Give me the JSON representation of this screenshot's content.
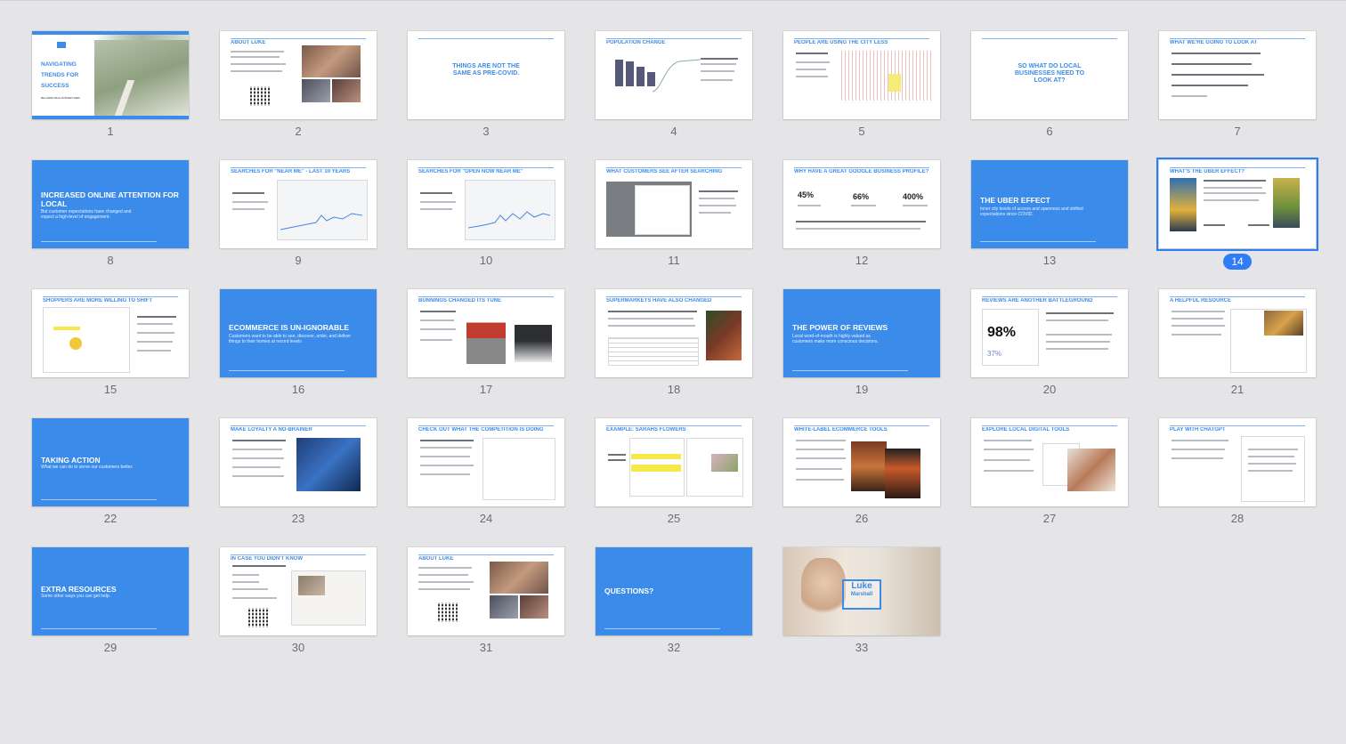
{
  "selected": 14,
  "slides": [
    {
      "n": "1",
      "title": "NAVIGATING TRENDS FOR SUCCESS",
      "sub": "BELLARINE SMALL BUSINESS WEEK"
    },
    {
      "n": "2",
      "title": "ABOUT LUKE"
    },
    {
      "n": "3",
      "title": "THINGS ARE NOT THE SAME AS PRE-COVID."
    },
    {
      "n": "4",
      "title": "POPULATION CHANGE"
    },
    {
      "n": "5",
      "title": "PEOPLE ARE USING THE CITY LESS"
    },
    {
      "n": "6",
      "title": "SO WHAT DO LOCAL BUSINESSES NEED TO LOOK AT?"
    },
    {
      "n": "7",
      "title": "WHAT WE'RE GOING TO LOOK AT"
    },
    {
      "n": "8",
      "title": "INCREASED ONLINE ATTENTION FOR LOCAL",
      "sub": "But customer expectations have changed and expect a high-level of engagement."
    },
    {
      "n": "9",
      "title": "SEARCHES FOR \"NEAR ME\" - LAST 10 YEARS"
    },
    {
      "n": "10",
      "title": "SEARCHES FOR \"OPEN NOW NEAR ME\""
    },
    {
      "n": "11",
      "title": "WHAT CUSTOMERS SEE AFTER SEARCHING"
    },
    {
      "n": "12",
      "title": "WHY HAVE A GREAT GOOGLE BUSINESS PROFILE?",
      "stats": [
        "45%",
        "66%",
        "400%"
      ]
    },
    {
      "n": "13",
      "title": "THE UBER EFFECT",
      "sub": "Inner city levels of access and openness and shifted expectations since COVID."
    },
    {
      "n": "14",
      "title": "WHAT'S THE UBER EFFECT?"
    },
    {
      "n": "15",
      "title": "SHOPPERS ARE MORE WILLING TO SHIFT"
    },
    {
      "n": "16",
      "title": "ECOMMERCE IS UN-IGNORABLE",
      "sub": "Customers want to be able to see, discover, order, and deliver things to their homes at record levels"
    },
    {
      "n": "17",
      "title": "BUNNINGS CHANGED ITS TUNE"
    },
    {
      "n": "18",
      "title": "SUPERMARKETS HAVE ALSO CHANGED"
    },
    {
      "n": "19",
      "title": "THE POWER OF REVIEWS",
      "sub": "Local word-of-mouth is highly valued as customers make more conscious decisions."
    },
    {
      "n": "20",
      "title": "REVIEWS ARE ANOTHER BATTLEGROUND",
      "stats": [
        "98%",
        "37%"
      ]
    },
    {
      "n": "21",
      "title": "A HELPFUL RESOURCE"
    },
    {
      "n": "22",
      "title": "TAKING ACTION",
      "sub": "What we can do to serve our customers better."
    },
    {
      "n": "23",
      "title": "MAKE LOYALTY A NO-BRAINER"
    },
    {
      "n": "24",
      "title": "CHECK OUT WHAT THE COMPETITION IS DOING"
    },
    {
      "n": "25",
      "title": "EXAMPLE: SARAHS FLOWERS"
    },
    {
      "n": "26",
      "title": "WHITE-LABEL ECOMMERCE TOOLS"
    },
    {
      "n": "27",
      "title": "EXPLORE LOCAL DIGITAL TOOLS"
    },
    {
      "n": "28",
      "title": "PLAY WITH CHATGPT"
    },
    {
      "n": "29",
      "title": "EXTRA RESOURCES",
      "sub": "Some other ways you can get help."
    },
    {
      "n": "30",
      "title": "IN CASE YOU DIDN'T KNOW"
    },
    {
      "n": "31",
      "title": "ABOUT LUKE"
    },
    {
      "n": "32",
      "title": "QUESTIONS?"
    },
    {
      "n": "33",
      "title": "Luke",
      "sub": "Marshall"
    }
  ]
}
